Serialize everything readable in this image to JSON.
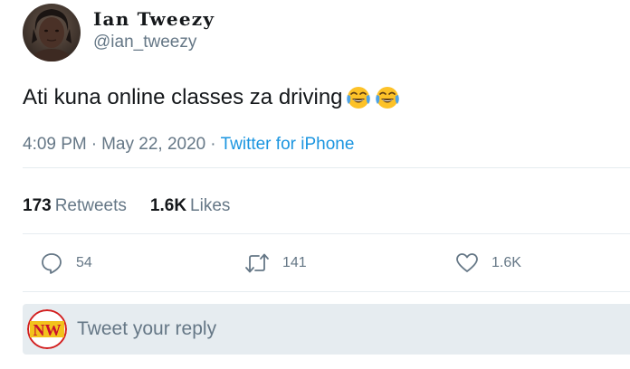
{
  "user": {
    "display_name": "Ian Tweezy",
    "handle": "@ian_tweezy",
    "avatar_icon": "profile-photo"
  },
  "tweet": {
    "text": "Ati kuna online classes za driving",
    "emojis": [
      "face-with-tears-of-joy",
      "face-with-tears-of-joy"
    ]
  },
  "meta": {
    "time": "4:09 PM",
    "date": "May 22, 2020",
    "separator": "·",
    "source": "Twitter for iPhone"
  },
  "stats": {
    "retweets_count": "173",
    "retweets_label": "Retweets",
    "likes_count": "1.6K",
    "likes_label": "Likes"
  },
  "actions": {
    "reply_count": "54",
    "retweet_count": "141",
    "like_count": "1.6K"
  },
  "reply": {
    "placeholder": "Tweet your reply",
    "avatar_text": "NW"
  },
  "colors": {
    "secondary_text": "#657786",
    "link": "#1b95e0",
    "divider": "#e6ecf0",
    "reply_bg": "#e6ecf0"
  }
}
